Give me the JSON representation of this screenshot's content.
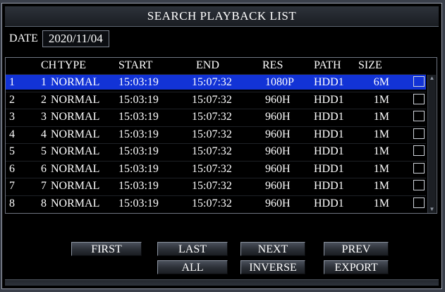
{
  "window": {
    "title": "SEARCH PLAYBACK LIST"
  },
  "date": {
    "label": "DATE",
    "value": "2020/11/04"
  },
  "table": {
    "headers": {
      "ch": "CH",
      "type": "TYPE",
      "start": "START",
      "end": "END",
      "res": "RES",
      "path": "PATH",
      "size": "SIZE"
    },
    "rows": [
      {
        "idx": "1",
        "ch": "1",
        "type": "NORMAL",
        "start": "15:03:19",
        "end": "15:07:32",
        "res": "1080P",
        "path": "HDD1",
        "size": "6M",
        "selected": true
      },
      {
        "idx": "2",
        "ch": "2",
        "type": "NORMAL",
        "start": "15:03:19",
        "end": "15:07:32",
        "res": "960H",
        "path": "HDD1",
        "size": "1M",
        "selected": false
      },
      {
        "idx": "3",
        "ch": "3",
        "type": "NORMAL",
        "start": "15:03:19",
        "end": "15:07:32",
        "res": "960H",
        "path": "HDD1",
        "size": "1M",
        "selected": false
      },
      {
        "idx": "4",
        "ch": "4",
        "type": "NORMAL",
        "start": "15:03:19",
        "end": "15:07:32",
        "res": "960H",
        "path": "HDD1",
        "size": "1M",
        "selected": false
      },
      {
        "idx": "5",
        "ch": "5",
        "type": "NORMAL",
        "start": "15:03:19",
        "end": "15:07:32",
        "res": "960H",
        "path": "HDD1",
        "size": "1M",
        "selected": false
      },
      {
        "idx": "6",
        "ch": "6",
        "type": "NORMAL",
        "start": "15:03:19",
        "end": "15:07:32",
        "res": "960H",
        "path": "HDD1",
        "size": "1M",
        "selected": false
      },
      {
        "idx": "7",
        "ch": "7",
        "type": "NORMAL",
        "start": "15:03:19",
        "end": "15:07:32",
        "res": "960H",
        "path": "HDD1",
        "size": "1M",
        "selected": false
      },
      {
        "idx": "8",
        "ch": "8",
        "type": "NORMAL",
        "start": "15:03:19",
        "end": "15:07:32",
        "res": "960H",
        "path": "HDD1",
        "size": "1M",
        "selected": false
      }
    ]
  },
  "buttons": {
    "first": "FIRST",
    "last": "LAST",
    "next": "NEXT",
    "prev": "PREV",
    "all": "ALL",
    "inverse": "INVERSE",
    "export": "EXPORT"
  },
  "icons": {
    "scroll_up": "scroll-up-arrow-icon",
    "scroll_down": "scroll-down-arrow-icon"
  },
  "colors": {
    "selection": "#1233d6",
    "background": "#000000",
    "text": "#ffffff"
  }
}
